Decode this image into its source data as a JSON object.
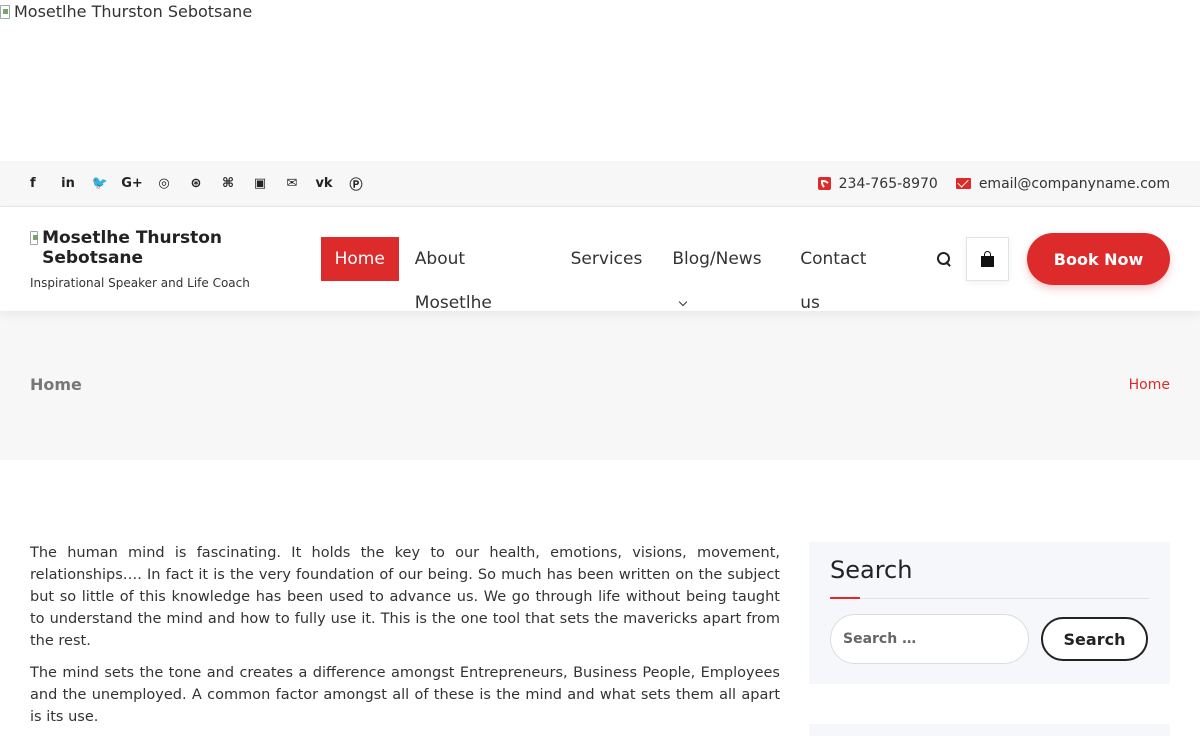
{
  "hero": {
    "image_alt": "Mosetlhe Thurston Sebotsane"
  },
  "topbar": {
    "social": [
      {
        "name": "facebook-icon",
        "glyph": "f"
      },
      {
        "name": "linkedin-icon",
        "glyph": "in"
      },
      {
        "name": "twitter-icon",
        "glyph": "🐦"
      },
      {
        "name": "google-plus-icon",
        "glyph": "G+"
      },
      {
        "name": "instagram-icon",
        "glyph": "◎"
      },
      {
        "name": "dribbble-icon",
        "glyph": "⊛"
      },
      {
        "name": "github-icon",
        "glyph": "⌘"
      },
      {
        "name": "foursquare-icon",
        "glyph": "▣"
      },
      {
        "name": "mail-icon",
        "glyph": "✉"
      },
      {
        "name": "vk-icon",
        "glyph": "vk"
      },
      {
        "name": "pinterest-icon",
        "glyph": "Ⓟ"
      }
    ],
    "phone": "234-765-8970",
    "email": "email@companyname.com"
  },
  "header": {
    "logo_alt": "Mosetlhe Thurston Sebotsane",
    "tagline": "Inspirational Speaker and Life Coach",
    "nav": [
      "Home",
      "About Mosetlhe",
      "Services",
      "Blog/News",
      "Contact us"
    ],
    "book_label": "Book Now"
  },
  "band": {
    "title": "Home",
    "crumb": "Home"
  },
  "article": {
    "p1": "The human mind is fascinating. It holds the key to our health, emotions, visions, movement, relationships…. In fact it is the very foundation of our being. So much has been written on the subject but so little of this knowledge has been used to advance us. We go through life without being taught to understand the mind and how to fully use it. This is the one tool that sets the mavericks apart from the rest.",
    "p2": "The mind sets the tone and creates a difference amongst Entrepreneurs, Business People, Employees and the unemployed. A common factor amongst all of these is the mind and what sets them all apart is its use."
  },
  "sidebar": {
    "search_title": "Search",
    "search_placeholder": "Search …",
    "search_button": "Search"
  },
  "colors": {
    "accent": "#dd2a2a",
    "topbar_bg": "#f7f7f7",
    "band_bg": "#f7f7f7",
    "widget_bg": "#f6f7fb"
  }
}
